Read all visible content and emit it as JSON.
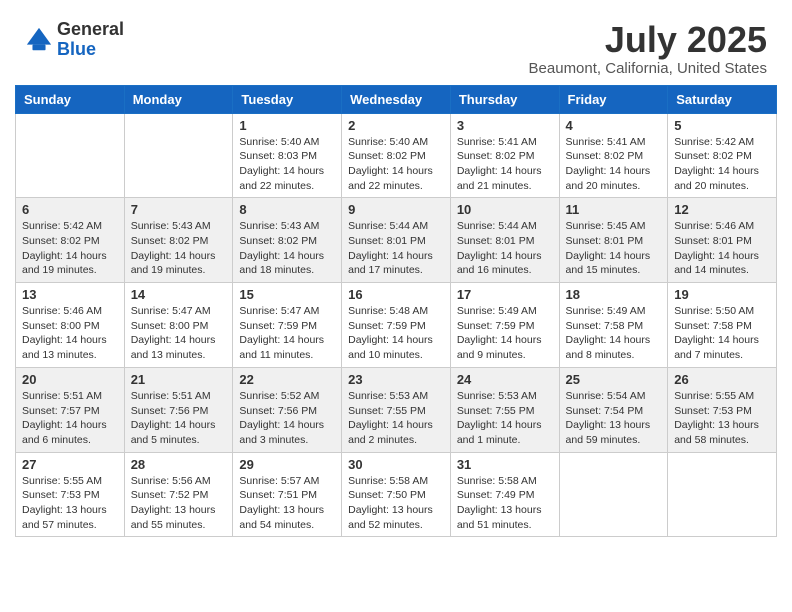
{
  "header": {
    "logo_line1": "General",
    "logo_line2": "Blue",
    "month_title": "July 2025",
    "subtitle": "Beaumont, California, United States"
  },
  "days_of_week": [
    "Sunday",
    "Monday",
    "Tuesday",
    "Wednesday",
    "Thursday",
    "Friday",
    "Saturday"
  ],
  "weeks": [
    [
      {
        "day": "",
        "info": ""
      },
      {
        "day": "",
        "info": ""
      },
      {
        "day": "1",
        "info": "Sunrise: 5:40 AM\nSunset: 8:03 PM\nDaylight: 14 hours\nand 22 minutes."
      },
      {
        "day": "2",
        "info": "Sunrise: 5:40 AM\nSunset: 8:02 PM\nDaylight: 14 hours\nand 22 minutes."
      },
      {
        "day": "3",
        "info": "Sunrise: 5:41 AM\nSunset: 8:02 PM\nDaylight: 14 hours\nand 21 minutes."
      },
      {
        "day": "4",
        "info": "Sunrise: 5:41 AM\nSunset: 8:02 PM\nDaylight: 14 hours\nand 20 minutes."
      },
      {
        "day": "5",
        "info": "Sunrise: 5:42 AM\nSunset: 8:02 PM\nDaylight: 14 hours\nand 20 minutes."
      }
    ],
    [
      {
        "day": "6",
        "info": "Sunrise: 5:42 AM\nSunset: 8:02 PM\nDaylight: 14 hours\nand 19 minutes."
      },
      {
        "day": "7",
        "info": "Sunrise: 5:43 AM\nSunset: 8:02 PM\nDaylight: 14 hours\nand 19 minutes."
      },
      {
        "day": "8",
        "info": "Sunrise: 5:43 AM\nSunset: 8:02 PM\nDaylight: 14 hours\nand 18 minutes."
      },
      {
        "day": "9",
        "info": "Sunrise: 5:44 AM\nSunset: 8:01 PM\nDaylight: 14 hours\nand 17 minutes."
      },
      {
        "day": "10",
        "info": "Sunrise: 5:44 AM\nSunset: 8:01 PM\nDaylight: 14 hours\nand 16 minutes."
      },
      {
        "day": "11",
        "info": "Sunrise: 5:45 AM\nSunset: 8:01 PM\nDaylight: 14 hours\nand 15 minutes."
      },
      {
        "day": "12",
        "info": "Sunrise: 5:46 AM\nSunset: 8:01 PM\nDaylight: 14 hours\nand 14 minutes."
      }
    ],
    [
      {
        "day": "13",
        "info": "Sunrise: 5:46 AM\nSunset: 8:00 PM\nDaylight: 14 hours\nand 13 minutes."
      },
      {
        "day": "14",
        "info": "Sunrise: 5:47 AM\nSunset: 8:00 PM\nDaylight: 14 hours\nand 13 minutes."
      },
      {
        "day": "15",
        "info": "Sunrise: 5:47 AM\nSunset: 7:59 PM\nDaylight: 14 hours\nand 11 minutes."
      },
      {
        "day": "16",
        "info": "Sunrise: 5:48 AM\nSunset: 7:59 PM\nDaylight: 14 hours\nand 10 minutes."
      },
      {
        "day": "17",
        "info": "Sunrise: 5:49 AM\nSunset: 7:59 PM\nDaylight: 14 hours\nand 9 minutes."
      },
      {
        "day": "18",
        "info": "Sunrise: 5:49 AM\nSunset: 7:58 PM\nDaylight: 14 hours\nand 8 minutes."
      },
      {
        "day": "19",
        "info": "Sunrise: 5:50 AM\nSunset: 7:58 PM\nDaylight: 14 hours\nand 7 minutes."
      }
    ],
    [
      {
        "day": "20",
        "info": "Sunrise: 5:51 AM\nSunset: 7:57 PM\nDaylight: 14 hours\nand 6 minutes."
      },
      {
        "day": "21",
        "info": "Sunrise: 5:51 AM\nSunset: 7:56 PM\nDaylight: 14 hours\nand 5 minutes."
      },
      {
        "day": "22",
        "info": "Sunrise: 5:52 AM\nSunset: 7:56 PM\nDaylight: 14 hours\nand 3 minutes."
      },
      {
        "day": "23",
        "info": "Sunrise: 5:53 AM\nSunset: 7:55 PM\nDaylight: 14 hours\nand 2 minutes."
      },
      {
        "day": "24",
        "info": "Sunrise: 5:53 AM\nSunset: 7:55 PM\nDaylight: 14 hours\nand 1 minute."
      },
      {
        "day": "25",
        "info": "Sunrise: 5:54 AM\nSunset: 7:54 PM\nDaylight: 13 hours\nand 59 minutes."
      },
      {
        "day": "26",
        "info": "Sunrise: 5:55 AM\nSunset: 7:53 PM\nDaylight: 13 hours\nand 58 minutes."
      }
    ],
    [
      {
        "day": "27",
        "info": "Sunrise: 5:55 AM\nSunset: 7:53 PM\nDaylight: 13 hours\nand 57 minutes."
      },
      {
        "day": "28",
        "info": "Sunrise: 5:56 AM\nSunset: 7:52 PM\nDaylight: 13 hours\nand 55 minutes."
      },
      {
        "day": "29",
        "info": "Sunrise: 5:57 AM\nSunset: 7:51 PM\nDaylight: 13 hours\nand 54 minutes."
      },
      {
        "day": "30",
        "info": "Sunrise: 5:58 AM\nSunset: 7:50 PM\nDaylight: 13 hours\nand 52 minutes."
      },
      {
        "day": "31",
        "info": "Sunrise: 5:58 AM\nSunset: 7:49 PM\nDaylight: 13 hours\nand 51 minutes."
      },
      {
        "day": "",
        "info": ""
      },
      {
        "day": "",
        "info": ""
      }
    ]
  ]
}
